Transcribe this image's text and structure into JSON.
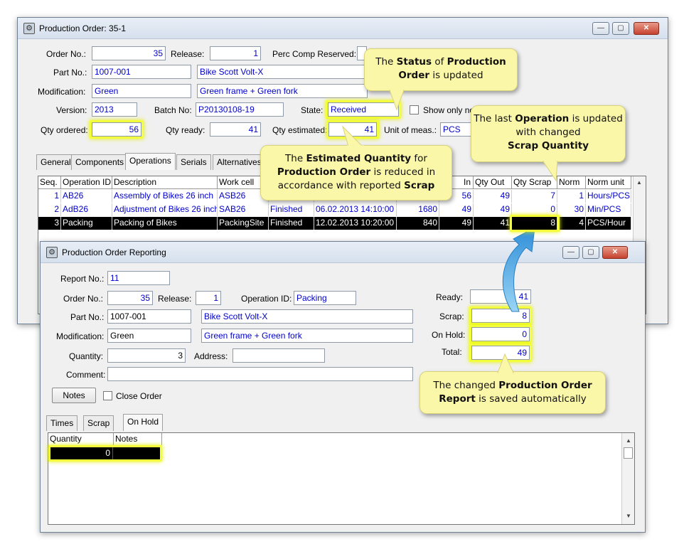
{
  "order_window": {
    "title": "Production Order: 35-1",
    "fields": {
      "order_no_label": "Order No.:",
      "order_no": "35",
      "release_label": "Release:",
      "release": "1",
      "perc_comp_label": "Perc Comp Reserved:",
      "part_no_label": "Part No.:",
      "part_no": "1007-001",
      "part_desc": "Bike Scott Volt-X",
      "modification_label": "Modification:",
      "modification": "Green",
      "modification_desc": "Green frame + Green fork",
      "version_label": "Version:",
      "version": "2013",
      "batch_label": "Batch No:",
      "batch": "P20130108-19",
      "state_label": "State:",
      "state": "Received",
      "show_only_label": "Show only no",
      "qty_ordered_label": "Qty ordered:",
      "qty_ordered": "56",
      "qty_ready_label": "Qty ready:",
      "qty_ready": "41",
      "qty_estimated_label": "Qty estimated:",
      "qty_estimated": "41",
      "unit_label": "Unit of meas.:",
      "unit": "PCS"
    },
    "tabs": [
      "General",
      "Components",
      "Operations",
      "Serials",
      "Alternatives"
    ],
    "active_tab": "Operations",
    "grid": {
      "headers": [
        "Seq.",
        "Operation ID",
        "Description",
        "Work cell",
        "",
        "",
        "",
        "Qty In",
        "Qty Out",
        "Qty Scrap",
        "Norm",
        "Norm unit"
      ],
      "header_visible": [
        "Seq.",
        "Operation ID",
        "Description",
        "Work cell",
        "In",
        "Qty Out",
        "Qty Scrap",
        "Norm",
        "Norm unit"
      ],
      "rows": [
        {
          "seq": "1",
          "op": "AB26",
          "desc": "Assembly of Bikes 26 inch",
          "cell": "ASB26",
          "status": "",
          "date": "",
          "time": "",
          "qin": "56",
          "qout": "49",
          "scrap": "7",
          "norm": "1",
          "unit": "Hours/PCS"
        },
        {
          "seq": "2",
          "op": "AdB26",
          "desc": "Adjustment of Bikes 26 inch",
          "cell": "SAB26",
          "status": "Finished",
          "date": "06.02.2013 14:10:00",
          "time": "1680",
          "qin": "49",
          "qout": "49",
          "scrap": "0",
          "norm": "30",
          "unit": "Min/PCS"
        },
        {
          "seq": "3",
          "op": "Packing",
          "desc": "Packing of Bikes",
          "cell": "PackingSite",
          "status": "Finished",
          "date": "12.02.2013 10:20:00",
          "time": "840",
          "qin": "49",
          "qout": "41",
          "scrap": "8",
          "norm": "4",
          "unit": "PCS/Hour"
        }
      ]
    }
  },
  "report_window": {
    "title": "Production Order Reporting",
    "report_no_label": "Report No.:",
    "report_no": "11",
    "order_no_label": "Order No.:",
    "order_no": "35",
    "release_label": "Release:",
    "release": "1",
    "operation_label": "Operation ID:",
    "operation": "Packing",
    "part_no_label": "Part No.:",
    "part_no": "1007-001",
    "part_desc": "Bike Scott Volt-X",
    "modification_label": "Modification:",
    "modification": "Green",
    "modification_desc": "Green frame + Green fork",
    "quantity_label": "Quantity:",
    "quantity": "3",
    "address_label": "Address:",
    "comment_label": "Comment:",
    "notes_button": "Notes",
    "close_order_label": "Close Order",
    "ready_label": "Ready:",
    "ready": "41",
    "scrap_label": "Scrap:",
    "scrap": "8",
    "onhold_label": "On Hold:",
    "onhold": "0",
    "total_label": "Total:",
    "total": "49",
    "tabs": [
      "Times",
      "Scrap",
      "On Hold"
    ],
    "active_tab": "On Hold",
    "hold_grid": {
      "headers": [
        "Quantity",
        "Notes"
      ],
      "row": {
        "quantity": "0",
        "notes": ""
      }
    }
  },
  "callouts": {
    "status": {
      "p1": "The ",
      "b1": "Status",
      "p2": " of ",
      "b2": "Production Order",
      "p3": " is updated"
    },
    "estimated": {
      "p1": "The ",
      "b1": "Estimated Quantity",
      "p2": " for ",
      "b2": "Production  Order",
      "p3": " is reduced in accordance with reported ",
      "b3": "Scrap"
    },
    "operation": {
      "p1": "The last ",
      "b1": "Operation",
      "p2": " is updated with changed ",
      "b2": "Scrap Quantity"
    },
    "report": {
      "p1": "The changed ",
      "b1": "Production Order Report",
      "p2": " is saved automatically"
    }
  },
  "colors": {
    "highlight": "#f2ff3a",
    "callout_bg": "#fbf7a8",
    "arrow": "#3aa0e0",
    "value_text": "#0000cc"
  }
}
